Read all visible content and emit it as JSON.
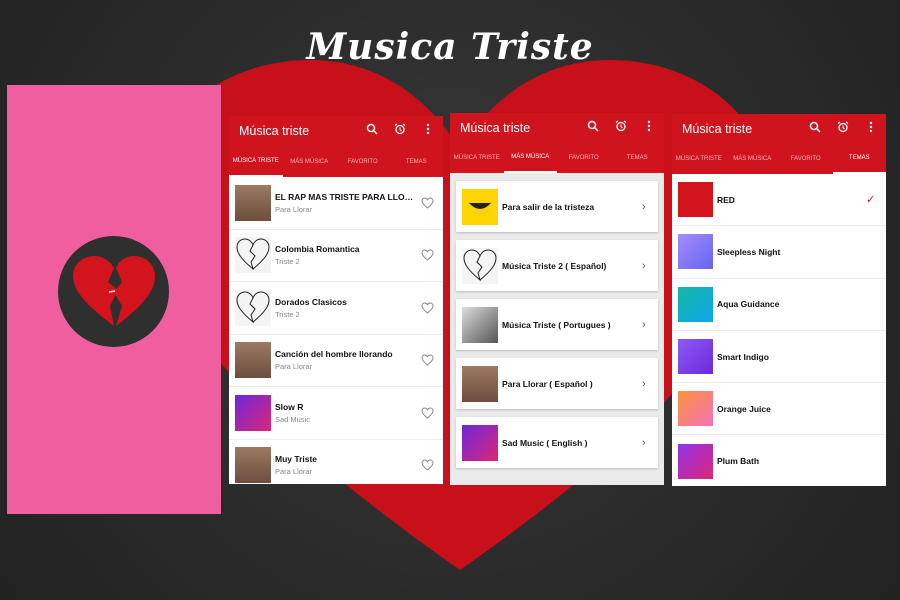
{
  "headline": "Musica Triste",
  "screens": [
    {
      "app_title": "Música triste",
      "tabs": [
        "MÚSICA TRISTE",
        "MÁS MÚSICA",
        "FAVORITO",
        "TEMAS"
      ],
      "active_tab": 0,
      "songs": [
        {
          "title": "EL RAP MAS TRISTE PARA LLOR...",
          "subtitle": "Para Llorar",
          "thumb": "crying-person"
        },
        {
          "title": "Colombia Romantica",
          "subtitle": "Triste 2",
          "thumb": "broken-heart-sketch"
        },
        {
          "title": "Dorados Clasicos",
          "subtitle": "Triste 2",
          "thumb": "broken-heart-sketch"
        },
        {
          "title": "Canción del hombre llorando",
          "subtitle": "Para Llorar",
          "thumb": "crying-person"
        },
        {
          "title": "Slow R",
          "subtitle": "Sad Music",
          "thumb": "neon-person"
        },
        {
          "title": "Muy Triste",
          "subtitle": "Para Llorar",
          "thumb": "crying-person"
        }
      ]
    },
    {
      "app_title": "Música triste",
      "tabs": [
        "MÚSICA TRISTE",
        "MÁS MÚSICA",
        "FAVORITO",
        "TEMAS"
      ],
      "active_tab": 1,
      "categories": [
        {
          "label": "Para salir de la tristeza",
          "thumb": "smile-yellow"
        },
        {
          "label": "Música Triste 2 ( Español)",
          "thumb": "broken-heart-sketch"
        },
        {
          "label": "Música Triste ( Portugues )",
          "thumb": "bw-person"
        },
        {
          "label": "Para Llorar ( Español )",
          "thumb": "crying-person"
        },
        {
          "label": "Sad Music ( English )",
          "thumb": "neon-person"
        }
      ]
    },
    {
      "app_title": "Música triste",
      "tabs": [
        "MÚSICA TRISTE",
        "MÁS MÚSICA",
        "FAVORITO",
        "TEMAS"
      ],
      "active_tab": 3,
      "themes": [
        {
          "name": "RED",
          "selected": true,
          "colors": [
            "#d3141c",
            "#d3141c"
          ]
        },
        {
          "name": "Sleepless Night",
          "selected": false,
          "colors": [
            "#a78bfa",
            "#6366f1"
          ]
        },
        {
          "name": "Aqua Guidance",
          "selected": false,
          "colors": [
            "#14b8a6",
            "#0ea5e9"
          ]
        },
        {
          "name": "Smart Indigo",
          "selected": false,
          "colors": [
            "#8b5cf6",
            "#6d28d9"
          ]
        },
        {
          "name": "Orange Juice",
          "selected": false,
          "colors": [
            "#fb923c",
            "#f472b6"
          ]
        },
        {
          "name": "Plum Bath",
          "selected": false,
          "colors": [
            "#9333ea",
            "#db2777"
          ]
        }
      ]
    }
  ],
  "colors": {
    "brand_red": "#d0141e",
    "pink_panel": "#ef5e9e",
    "logo_bg": "#2f2f2f"
  }
}
